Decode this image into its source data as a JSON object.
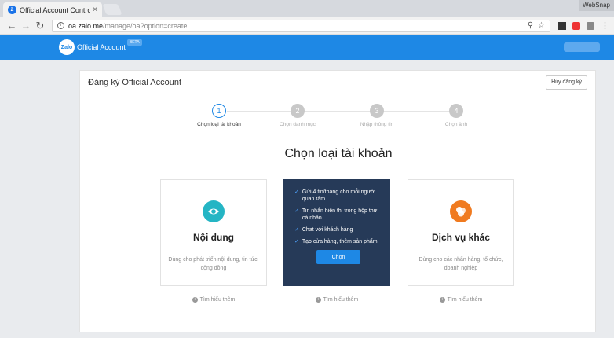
{
  "browser": {
    "tab_title": "Official Account Control",
    "tab_close": "×",
    "corner_label": "WebSnap",
    "url_host": "oa.zalo.me",
    "url_path": "/manage/oa?option=create"
  },
  "header": {
    "logo": "Zalo",
    "brand": "Official Account",
    "badge": "BETA"
  },
  "card": {
    "title": "Đăng ký Official Account",
    "cancel_label": "Hủy đăng ký"
  },
  "steps": [
    {
      "num": "1",
      "label": "Chọn loại tài khoản"
    },
    {
      "num": "2",
      "label": "Chọn danh mục"
    },
    {
      "num": "3",
      "label": "Nhập thông tin"
    },
    {
      "num": "4",
      "label": "Chọn ảnh"
    }
  ],
  "heading": "Chọn loại tài khoản",
  "options": {
    "content": {
      "title": "Nội dung",
      "desc": "Dùng cho phát triển nội dung, tin tức, cộng đồng"
    },
    "features": [
      "Gửi 4 tin/tháng cho mỗi người quan tâm",
      "Tin nhắn hiển thị trong hộp thư cá nhân",
      "Chat với khách hàng",
      "Tạo cửa hàng, thêm sản phẩm"
    ],
    "choose_label": "Chọn",
    "service": {
      "title": "Dịch vụ khác",
      "desc": "Dùng cho các nhãn hàng, tổ chức, doanh nghiệp"
    }
  },
  "learn_more": "Tìm hiểu thêm",
  "colors": {
    "brand": "#1e88e5",
    "dark_card": "#263a58",
    "teal": "#25b5c4",
    "orange": "#f07a1f"
  }
}
